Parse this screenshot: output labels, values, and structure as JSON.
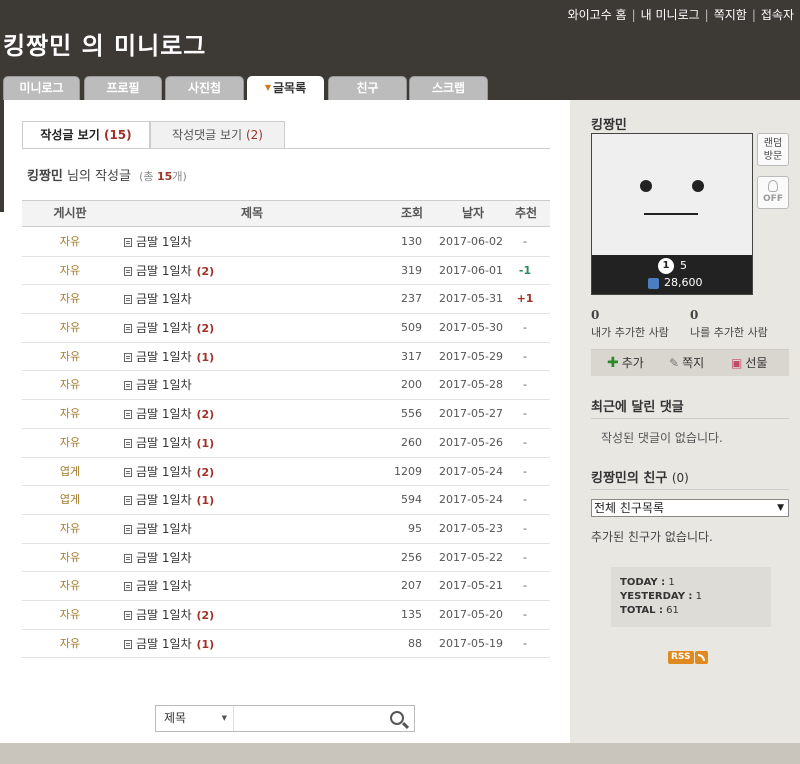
{
  "header": {
    "title": "킹짱민 의 미니로그",
    "links": [
      "와이고수 홈",
      "내 미니로그",
      "쪽지함",
      "접속자"
    ]
  },
  "tabs": [
    {
      "label": "미니로그",
      "active": false
    },
    {
      "label": "프로필",
      "active": false
    },
    {
      "label": "사진첩",
      "active": false
    },
    {
      "label": "글목록",
      "active": true
    },
    {
      "label": "친구",
      "active": false
    },
    {
      "label": "스크랩",
      "active": false
    }
  ],
  "subtabs": [
    {
      "label": "작성글 보기",
      "count": "(15)",
      "active": true
    },
    {
      "label": "작성댓글 보기",
      "count": "(2)",
      "active": false
    }
  ],
  "heading": {
    "name": "킹짱민",
    "suffix": "님의 작성글",
    "total_prefix": "(총",
    "total_count": "15",
    "total_suffix": "개)"
  },
  "table": {
    "columns": [
      "게시판",
      "제목",
      "조회",
      "날자",
      "추천"
    ],
    "rows": [
      {
        "board": "자유",
        "title": "금딸 1일차",
        "comments": "",
        "views": "130",
        "date": "2017-06-02",
        "rec": "-"
      },
      {
        "board": "자유",
        "title": "금딸 1일차",
        "comments": "(2)",
        "views": "319",
        "date": "2017-06-01",
        "rec": "-1"
      },
      {
        "board": "자유",
        "title": "금딸 1일차",
        "comments": "",
        "views": "237",
        "date": "2017-05-31",
        "rec": "+1"
      },
      {
        "board": "자유",
        "title": "금딸 1일차",
        "comments": "(2)",
        "views": "509",
        "date": "2017-05-30",
        "rec": "-"
      },
      {
        "board": "자유",
        "title": "금딸 1일차",
        "comments": "(1)",
        "views": "317",
        "date": "2017-05-29",
        "rec": "-"
      },
      {
        "board": "자유",
        "title": "금딸 1일차",
        "comments": "",
        "views": "200",
        "date": "2017-05-28",
        "rec": "-"
      },
      {
        "board": "자유",
        "title": "금딸 1일차",
        "comments": "(2)",
        "views": "556",
        "date": "2017-05-27",
        "rec": "-"
      },
      {
        "board": "자유",
        "title": "금딸 1일차",
        "comments": "(1)",
        "views": "260",
        "date": "2017-05-26",
        "rec": "-"
      },
      {
        "board": "엽게",
        "title": "금딸 1일차",
        "comments": "(2)",
        "views": "1209",
        "date": "2017-05-24",
        "rec": "-"
      },
      {
        "board": "엽게",
        "title": "금딸 1일차",
        "comments": "(1)",
        "views": "594",
        "date": "2017-05-24",
        "rec": "-"
      },
      {
        "board": "자유",
        "title": "금딸 1일차",
        "comments": "",
        "views": "95",
        "date": "2017-05-23",
        "rec": "-"
      },
      {
        "board": "자유",
        "title": "금딸 1일차",
        "comments": "",
        "views": "256",
        "date": "2017-05-22",
        "rec": "-"
      },
      {
        "board": "자유",
        "title": "금딸 1일차",
        "comments": "",
        "views": "207",
        "date": "2017-05-21",
        "rec": "-"
      },
      {
        "board": "자유",
        "title": "금딸 1일차",
        "comments": "(2)",
        "views": "135",
        "date": "2017-05-20",
        "rec": "-"
      },
      {
        "board": "자유",
        "title": "금딸 1일차",
        "comments": "(1)",
        "views": "88",
        "date": "2017-05-19",
        "rec": "-"
      }
    ]
  },
  "search": {
    "scope": "제목",
    "value": ""
  },
  "sidebar": {
    "owner": "킹짱민",
    "random_visit": "랜덤\n방문",
    "toggle": "OFF",
    "level": "1",
    "level_value": "5",
    "points": "28,600",
    "added_by_me_count": "0",
    "added_by_me_label": "내가 추가한 사람",
    "added_me_count": "0",
    "added_me_label": "나를 추가한 사람",
    "actions": [
      {
        "label": "추가",
        "icon": "plus-icon"
      },
      {
        "label": "쪽지",
        "icon": "note-icon"
      },
      {
        "label": "선물",
        "icon": "gift-icon"
      }
    ],
    "recent_comments_title": "최근에 달린 댓글",
    "recent_comments_empty": "작성된 댓글이 없습니다.",
    "friends_title": "킹짱민의 친구",
    "friends_count": "(0)",
    "friends_select": "전체 친구목록",
    "friends_empty": "추가된 친구가 없습니다.",
    "visits": {
      "today_label": "TODAY :",
      "today": "1",
      "yesterday_label": "YESTERDAY :",
      "yesterday": "1",
      "total_label": "TOTAL :",
      "total": "61"
    },
    "rss": "RSS"
  },
  "colors": {
    "header_bg": "#3d3a36",
    "accent_red": "#a0322a",
    "board_gold": "#a07a2a",
    "rss_orange": "#e08a1e"
  }
}
